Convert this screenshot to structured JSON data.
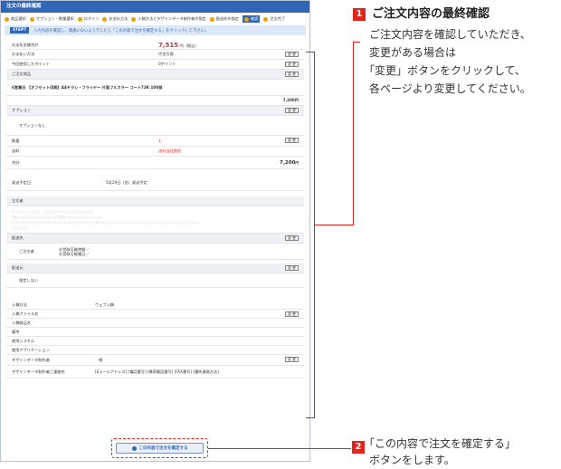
{
  "screen": {
    "title": "注文の最終確認",
    "steps": [
      "商品選択",
      "オプション・数量選択",
      "ログイン",
      "お支払方法",
      "入稿方法とデザインデータ制作者の指定",
      "配送先の指定",
      "確認",
      "注文完了"
    ],
    "info_tag": "STEP7",
    "info_text": "入力内容を確認し、間違いないようでしたら「この内容で注文を確定する」をクリックして下さい。",
    "change_label": "変 更",
    "rows": {
      "total_label": "お支払金額合計",
      "total_value": "7,515",
      "total_unit": "円（税込）",
      "pay_label": "お支払い方法",
      "pay_value": "代金引換",
      "point_label": "今回使用したポイント",
      "point_value": "0ポイント",
      "product_label": "ご注文商品",
      "product_value": "6営業日 【オフセット印刷】A4チラシ・フライヤー 片面フルカラー コート73K 100部",
      "product_price": "7,200円",
      "option_label": "オプション",
      "option_value": "オプションなし",
      "qty_label": "数量",
      "qty_value": "1",
      "ship_label": "送料",
      "ship_value": "送料当社負担",
      "sum_label": "合計",
      "sum_value": "7,200",
      "sum_unit": "円",
      "date_label": "発送予定日",
      "date_value": "5月29日（金）発送予定",
      "memo_label": "注文者",
      "memo_blur": "〒○○○-○○○○ ○○○○○○○○○○○○○○○○",
      "memo_blur2": "TEL:○○○-○○○-○○○○ FAX:○○○-○○○-○○○○",
      "memo_blur3": "○○○○○○○○○○○○○○○○○○○○○○○○○○○○○○○○○○○○○○○○○○○○○○○○○○○○○○○○○",
      "memo_blur4": "○○○○○",
      "dest_label": "配送先",
      "dest_sub": "ご注文者",
      "dest_t1": "お受取可能時間／",
      "dest_t2": "お受取可能曜日／",
      "src_label": "配送元",
      "src_value": "指定しない",
      "upload_label": "入稿方法",
      "upload_value": "ウェブ入稿",
      "file_label": "入稿ファイル名",
      "item_label": "入稿商品名",
      "note_label": "備考",
      "sys_label": "使用システム",
      "app_label": "使用アプリケーション",
      "designer_label": "デザインデータ制作者",
      "designer_value": "様",
      "contact_label": "デザインデータ制作者ご連絡先",
      "contact_value": "[Eメールアドレス] [電話番号] [携帯電話番号] [FAX番号] [優先連絡方法]"
    },
    "confirm_label": "この内容で注文を確定する"
  },
  "annotations": {
    "n1": "1",
    "h1": "ご注文内容の最終確認",
    "l1": "ご注文内容を確認していただき、",
    "l2": "変更がある場合は",
    "l3": "「変更」ボタンをクリックして、",
    "l4": "各ページより変更してください。",
    "n2": "2",
    "l5": "「この内容で注文を確定する」",
    "l6": "ボタンをします。"
  },
  "colors": {
    "accent": "#2f66b8",
    "marker": "#e2251b",
    "step_dot": "#f0a000"
  }
}
